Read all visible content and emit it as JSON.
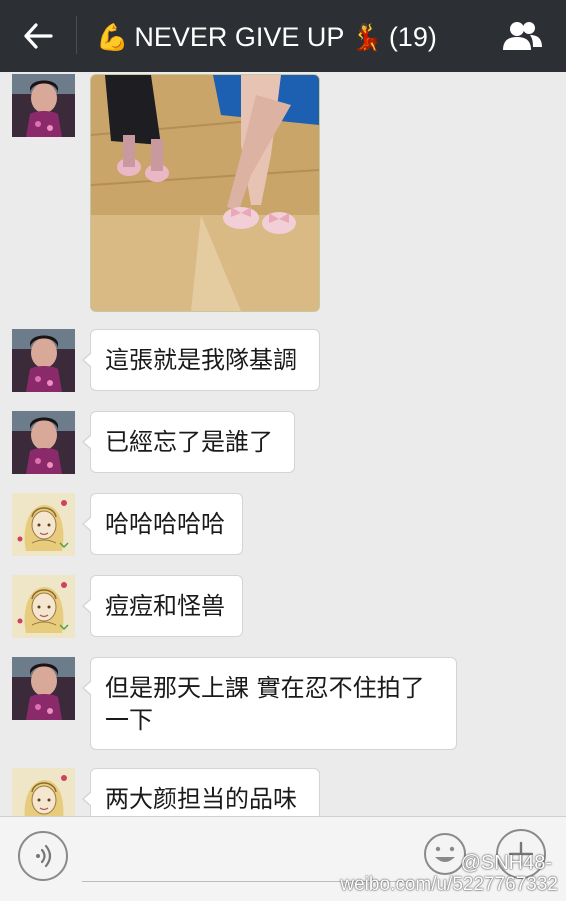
{
  "header": {
    "title_emoji_left": "💪",
    "title": "NEVER GIVE UP",
    "title_emoji_right": "💃",
    "member_count": "(19)",
    "back_icon": "arrow-left-icon",
    "group_icon": "group-members-icon"
  },
  "messages": [
    {
      "sender": "user-a",
      "type": "image"
    },
    {
      "sender": "user-a",
      "type": "text",
      "text": "這張就是我隊基調"
    },
    {
      "sender": "user-a",
      "type": "text",
      "text": "已經忘了是誰了"
    },
    {
      "sender": "user-b",
      "type": "text",
      "text": "哈哈哈哈哈"
    },
    {
      "sender": "user-b",
      "type": "text",
      "text": "痘痘和怪兽"
    },
    {
      "sender": "user-a",
      "type": "text",
      "line1": "但是那天上課 實在忍不住拍了",
      "line2": "一下"
    },
    {
      "sender": "user-b",
      "type": "text",
      "text": "两大颜担当的品味"
    }
  ],
  "input": {
    "voice_icon": "voice-icon",
    "emoji_icon": "smiley-icon",
    "plus_icon": "plus-icon"
  },
  "watermark": {
    "handle": "@SNH48-",
    "url": "weibo.com/u/5227767332"
  }
}
